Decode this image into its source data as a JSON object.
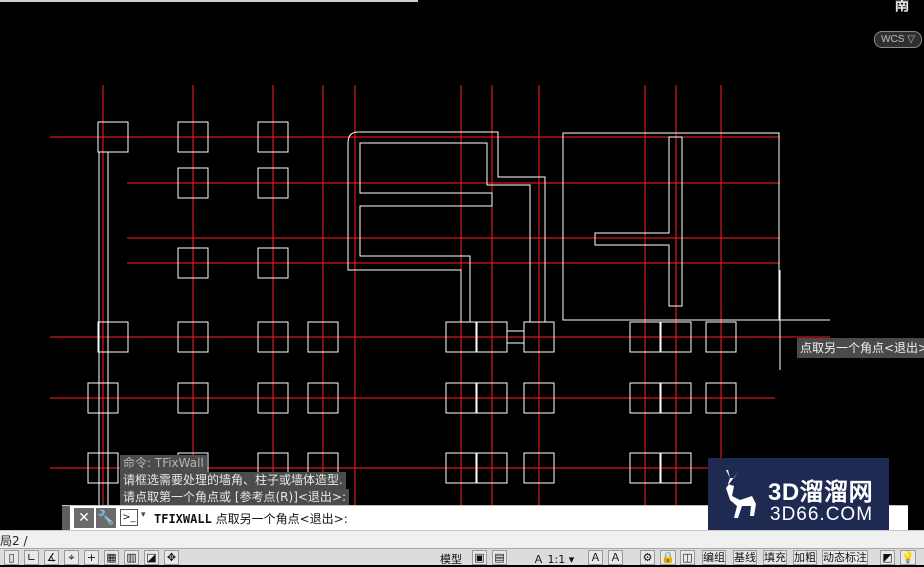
{
  "navigation": {
    "viewcube_label": "南",
    "wcs_label": "WCS ▽"
  },
  "cursor_tooltip": "点取另一个角点<退出>",
  "command_history": [
    "命令: TFixWall",
    "请框选需要处理的墙角、柱子或墙体造型.",
    "请点取第一个角点或 [参考点(R)]<退出>:"
  ],
  "command_line": {
    "close_icon": "close-icon",
    "settings_icon": "wrench-icon",
    "command_name": "TFIXWALL",
    "prompt": "点取另一个角点<退出>:"
  },
  "watermark": {
    "brand": "3D溜溜网",
    "domain": "3D66.COM"
  },
  "layout_tab": "局2 /",
  "status_bar": {
    "model_label": "模型",
    "scale_label": "1:1",
    "items": [
      "编组",
      "基线",
      "填充",
      "加粗",
      "动态标注"
    ]
  },
  "colors": {
    "axis": "#ff2020",
    "wall": "#ffffff",
    "background": "#000000"
  }
}
